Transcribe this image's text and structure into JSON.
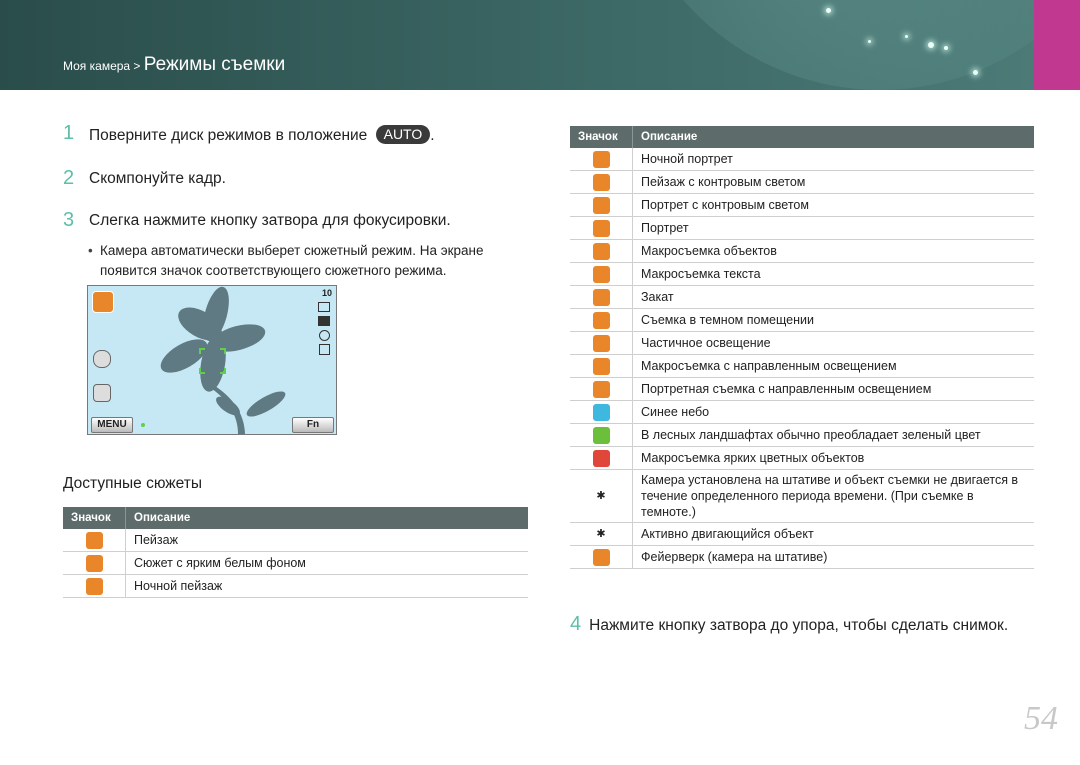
{
  "header": {
    "breadcrumb_parent": "Моя камера >",
    "breadcrumb_current": "Режимы съемки",
    "accent_color": "#c0388f"
  },
  "steps": [
    {
      "num": "1",
      "text": "Поверните диск режимов в положение",
      "badge": "AUTO",
      "suffix": "."
    },
    {
      "num": "2",
      "text": "Скомпонуйте кадр."
    },
    {
      "num": "3",
      "text": "Слегка нажмите кнопку затвора для фокусировки."
    }
  ],
  "bullet": "Камера автоматически выберет сюжетный режим. На экране появится значок соответствующего сюжетного режима.",
  "camera_screen": {
    "counter": "10",
    "menu_label": "MENU",
    "fn_label": "Fn",
    "scene_icon": "macro-icon"
  },
  "available_scenes": {
    "title": "Доступные сюжеты",
    "col_icon": "Значок",
    "col_desc": "Описание",
    "rows": [
      {
        "icon": "landscape-icon",
        "color": "#e9862a",
        "desc": "Пейзаж"
      },
      {
        "icon": "white-scene-icon",
        "color": "#e9862a",
        "desc": "Сюжет с ярким белым фоном"
      },
      {
        "icon": "night-icon",
        "color": "#e9862a",
        "desc": "Ночной пейзаж"
      }
    ]
  },
  "scene_table": {
    "col_icon": "Значок",
    "col_desc": "Описание",
    "rows": [
      {
        "icon": "night-portrait-icon",
        "color": "#e9862a",
        "desc": "Ночной портрет"
      },
      {
        "icon": "backlight-landscape-icon",
        "color": "#e9862a",
        "desc": "Пейзаж с контровым светом"
      },
      {
        "icon": "backlight-portrait-icon",
        "color": "#e9862a",
        "desc": "Портрет с контровым светом"
      },
      {
        "icon": "portrait-icon",
        "color": "#e9862a",
        "desc": "Портрет"
      },
      {
        "icon": "macro-icon",
        "color": "#e9862a",
        "desc": "Макросъемка объектов"
      },
      {
        "icon": "macro-text-icon",
        "color": "#e9862a",
        "desc": "Макросъемка текста"
      },
      {
        "icon": "sunset-icon",
        "color": "#e9862a",
        "desc": "Закат"
      },
      {
        "icon": "indoor-icon",
        "color": "#e9862a",
        "desc": "Съемка в темном помещении"
      },
      {
        "icon": "partial-light-icon",
        "color": "#e9862a",
        "desc": "Частичное освещение"
      },
      {
        "icon": "macro-spotlight-icon",
        "color": "#e9862a",
        "desc": "Макросъемка с направленным освещением"
      },
      {
        "icon": "portrait-spotlight-icon",
        "color": "#e9862a",
        "desc": "Портретная съемка с направленным освещением"
      },
      {
        "icon": "blue-sky-icon",
        "color": "#3fb8e0",
        "desc": "Синее небо"
      },
      {
        "icon": "forest-icon",
        "color": "#6bbf3a",
        "desc": "В лесных ландшафтах обычно преобладает зеленый цвет"
      },
      {
        "icon": "macro-color-icon",
        "color": "#e0463a",
        "desc": "Макросъемка ярких цветных объектов"
      },
      {
        "icon": "tripod-icon",
        "color": "#222222",
        "desc": "Камера установлена на штативе и объект съемки не двигается в течение определенного периода времени. (При съемке в темноте.)"
      },
      {
        "icon": "action-icon",
        "color": "#222222",
        "desc": "Активно двигающийся объект"
      },
      {
        "icon": "fireworks-icon",
        "color": "#e9862a",
        "desc": "Фейерверк (камера на штативе)"
      }
    ]
  },
  "step4": {
    "num": "4",
    "text": "Нажмите кнопку затвора до упора, чтобы сделать снимок."
  },
  "page_number": "54"
}
